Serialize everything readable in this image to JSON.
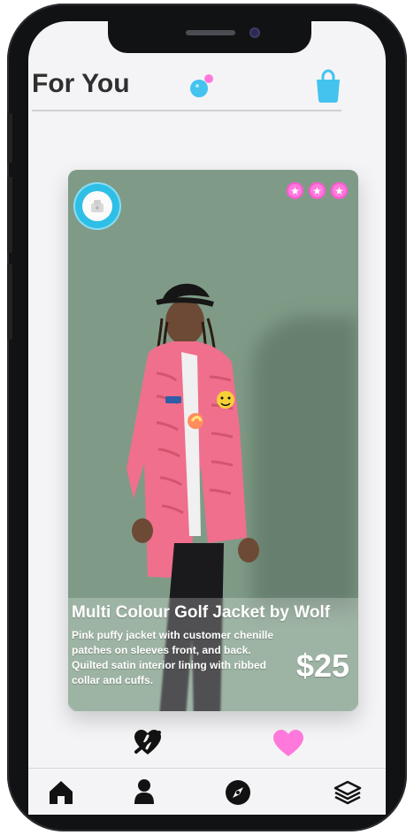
{
  "header": {
    "title": "For You"
  },
  "icons": {
    "bubbles": "bubbles-icon",
    "bag": "shopping-bag-icon",
    "seller": "seller-avatar-icon",
    "star": "star-icon",
    "dislike": "broken-heart-icon",
    "like": "heart-icon",
    "home": "home-icon",
    "profile": "profile-icon",
    "explore": "compass-icon",
    "layers": "layers-icon"
  },
  "product": {
    "title": "Multi Colour Golf Jacket by Wolf",
    "description": "Pink puffy jacket with customer chenille patches on sleeves front, and back. Quilted satin interior lining with ribbed collar and cuffs.",
    "price": "$25",
    "rating": 3
  },
  "colors": {
    "accent": "#43c3ee",
    "rating": "#ff79dc",
    "like": "#ff79dc",
    "jacket": "#ef6f8d",
    "card_bg": "#7f9b87"
  }
}
